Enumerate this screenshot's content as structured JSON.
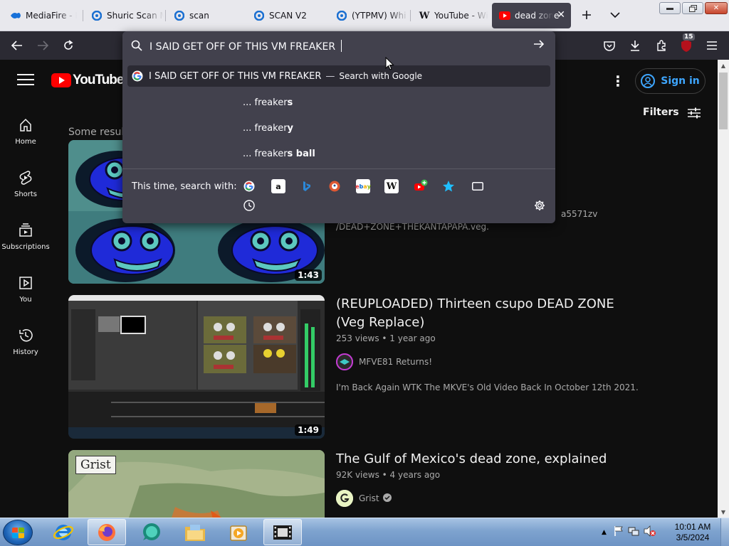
{
  "browser": {
    "tabs": [
      {
        "title": "MediaFire - Fi",
        "favicon": "mediafire-icon"
      },
      {
        "title": "Shuric Scan M",
        "favicon": "firefox-swirl-icon"
      },
      {
        "title": "scan",
        "favicon": "firefox-swirl-icon"
      },
      {
        "title": "SCAN V2",
        "favicon": "firefox-swirl-icon"
      },
      {
        "title": "(YTPMV) Whi",
        "favicon": "firefox-swirl-icon"
      },
      {
        "title": "YouTube - Wi",
        "favicon": "wikipedia-icon"
      },
      {
        "title": "dead zone",
        "favicon": "youtube-icon",
        "active": true
      }
    ],
    "extensions_badge": "15",
    "urlbar": {
      "query": "I SAID GET OFF OF THIS VM FREAKER",
      "main_suggestion": "I SAID GET OFF OF THIS VM FREAKER",
      "main_suggestion_action": "Search with Google",
      "suggestions": [
        {
          "prefix": "... freaker",
          "bold": "s"
        },
        {
          "prefix": "... freaker",
          "bold": "y"
        },
        {
          "prefix": "... freaker",
          "bold": "s ball"
        }
      ],
      "this_time_label": "This time, search with:",
      "engines": [
        "google",
        "amazon",
        "bing",
        "duckduckgo",
        "ebay",
        "wikipedia",
        "youtube",
        "bookmarks",
        "tabs",
        "history"
      ]
    }
  },
  "youtube": {
    "logo": "YouTube",
    "sign_in": "Sign in",
    "filters": "Filters",
    "sidebar": [
      {
        "label": "Home",
        "icon": "home-icon"
      },
      {
        "label": "Shorts",
        "icon": "shorts-icon"
      },
      {
        "label": "Subscriptions",
        "icon": "subscriptions-icon"
      },
      {
        "label": "You",
        "icon": "you-icon"
      },
      {
        "label": "History",
        "icon": "history-icon"
      }
    ],
    "notice": "Some results",
    "videos": [
      {
        "duration": "1:43",
        "desc_partial_1": "a5571zv",
        "desc_partial_2": "/DEAD+ZONE+THEKANTAPAPA.veg."
      },
      {
        "title": "(REUPLOADED) Thirteen csupo DEAD ZONE (Veg Replace)",
        "meta": "253 views • 1 year ago",
        "channel": "MFVE81 Returns!",
        "description": "I'm Back Again WTK The MKVE's Old Video Back In October 12th 2021.",
        "duration": "1:49"
      },
      {
        "title": "The Gulf of Mexico's dead zone, explained",
        "meta": "92K views • 4 years ago",
        "channel": "Grist",
        "thumb_label": "Grist"
      }
    ]
  },
  "taskbar": {
    "time": "10:01 AM",
    "date": "3/5/2024",
    "apps": [
      "internet-explorer",
      "firefox",
      "chat-app",
      "file-explorer",
      "media-player",
      "film-editor"
    ]
  }
}
